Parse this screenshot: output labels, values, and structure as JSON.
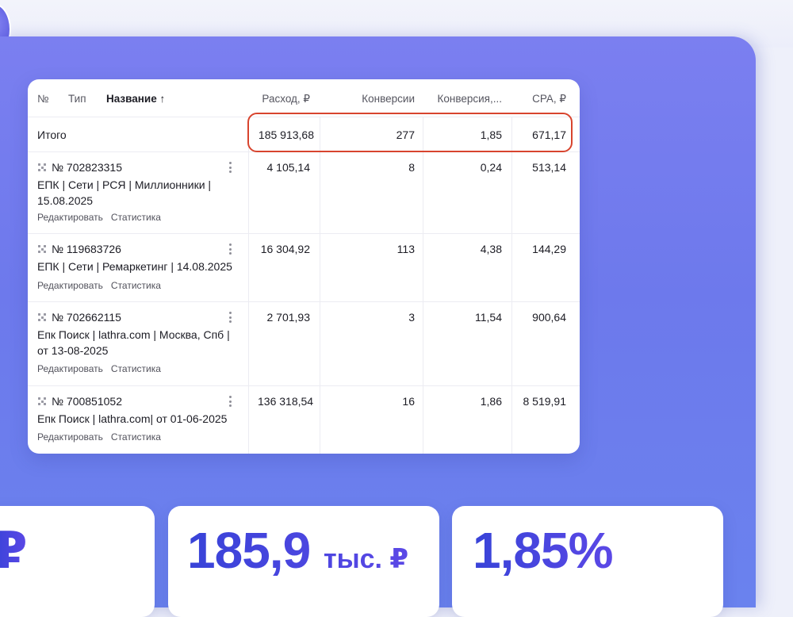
{
  "table": {
    "headers": {
      "num": "№",
      "type": "Тип",
      "name": "Название",
      "sort_arrow": "↑",
      "spend": "Расход, ₽",
      "conversions": "Конверсии",
      "conv_rate": "Конверсия,...",
      "cpa": "CPA, ₽"
    },
    "total": {
      "label": "Итого",
      "spend": "185 913,68",
      "conversions": "277",
      "conv_rate": "1,85",
      "cpa": "671,17"
    },
    "rows": [
      {
        "number": "№ 702823315",
        "name": "ЕПК | Сети | РСЯ | Миллионники | 15.08.2025",
        "edit": "Редактировать",
        "stats": "Статистика",
        "spend": "4 105,14",
        "conversions": "8",
        "conv_rate": "0,24",
        "cpa": "513,14"
      },
      {
        "number": "№ 119683726",
        "name": "ЕПК | Сети | Ремаркетинг | 14.08.2025",
        "edit": "Редактировать",
        "stats": "Статистика",
        "spend": "16 304,92",
        "conversions": "113",
        "conv_rate": "4,38",
        "cpa": "144,29"
      },
      {
        "number": "№ 702662115",
        "name": "Епк Поиск | lathra.com | Москва, Спб | от 13-08-2025",
        "edit": "Редактировать",
        "stats": "Статистика",
        "spend": "2 701,93",
        "conversions": "3",
        "conv_rate": "11,54",
        "cpa": "900,64"
      },
      {
        "number": "№ 700851052",
        "name": "Епк Поиск | lathra.com| от 01-06-2025",
        "edit": "Редактировать",
        "stats": "Статистика",
        "spend": "136 318,54",
        "conversions": "16",
        "conv_rate": "1,86",
        "cpa": "8 519,91"
      }
    ]
  },
  "stats": {
    "card1": {
      "value": "₽"
    },
    "card2": {
      "value": "185,9",
      "unit": "тыс. ₽"
    },
    "card3": {
      "value": "1,85%"
    }
  },
  "colors": {
    "panel": "#7b7ff0",
    "highlight": "#d8442e",
    "stat_text": "#3843d8"
  }
}
